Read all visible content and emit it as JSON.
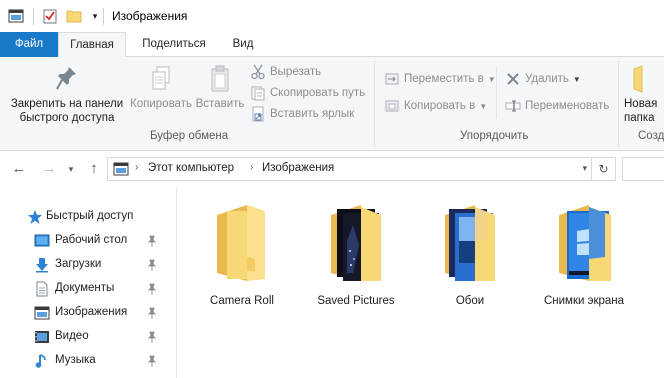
{
  "window": {
    "title": "Изображения"
  },
  "tabs": {
    "file": "Файл",
    "home": "Главная",
    "share": "Поделиться",
    "view": "Вид"
  },
  "ribbon": {
    "clipboard": {
      "pin_label_1": "Закрепить на панели",
      "pin_label_2": "быстрого доступа",
      "copy": "Копировать",
      "paste": "Вставить",
      "cut": "Вырезать",
      "copy_path": "Скопировать путь",
      "paste_shortcut": "Вставить ярлык",
      "group_label": "Буфер обмена"
    },
    "organize": {
      "move_to": "Переместить в",
      "copy_to": "Копировать в",
      "delete": "Удалить",
      "rename": "Переименовать",
      "group_label": "Упорядочить"
    },
    "new": {
      "new_folder_1": "Новая",
      "new_folder_2": "папка",
      "group_label_partial": "Созд"
    }
  },
  "address": {
    "crumbs": [
      "Этот компьютер",
      "Изображения"
    ]
  },
  "sidebar": {
    "items": [
      {
        "label": "Быстрый доступ",
        "icon": "star-icon"
      },
      {
        "label": "Рабочий стол",
        "icon": "desktop-icon"
      },
      {
        "label": "Загрузки",
        "icon": "download-icon"
      },
      {
        "label": "Документы",
        "icon": "document-icon"
      },
      {
        "label": "Изображения",
        "icon": "pictures-icon"
      },
      {
        "label": "Видео",
        "icon": "video-icon"
      },
      {
        "label": "Музыка",
        "icon": "music-icon"
      }
    ]
  },
  "folders": [
    {
      "label": "Camera Roll"
    },
    {
      "label": "Saved Pictures"
    },
    {
      "label": "Обои"
    },
    {
      "label": "Снимки экрана"
    }
  ],
  "colors": {
    "accent": "#1979ca",
    "folder": "#f8d775",
    "folder_dark": "#e7b94f"
  }
}
